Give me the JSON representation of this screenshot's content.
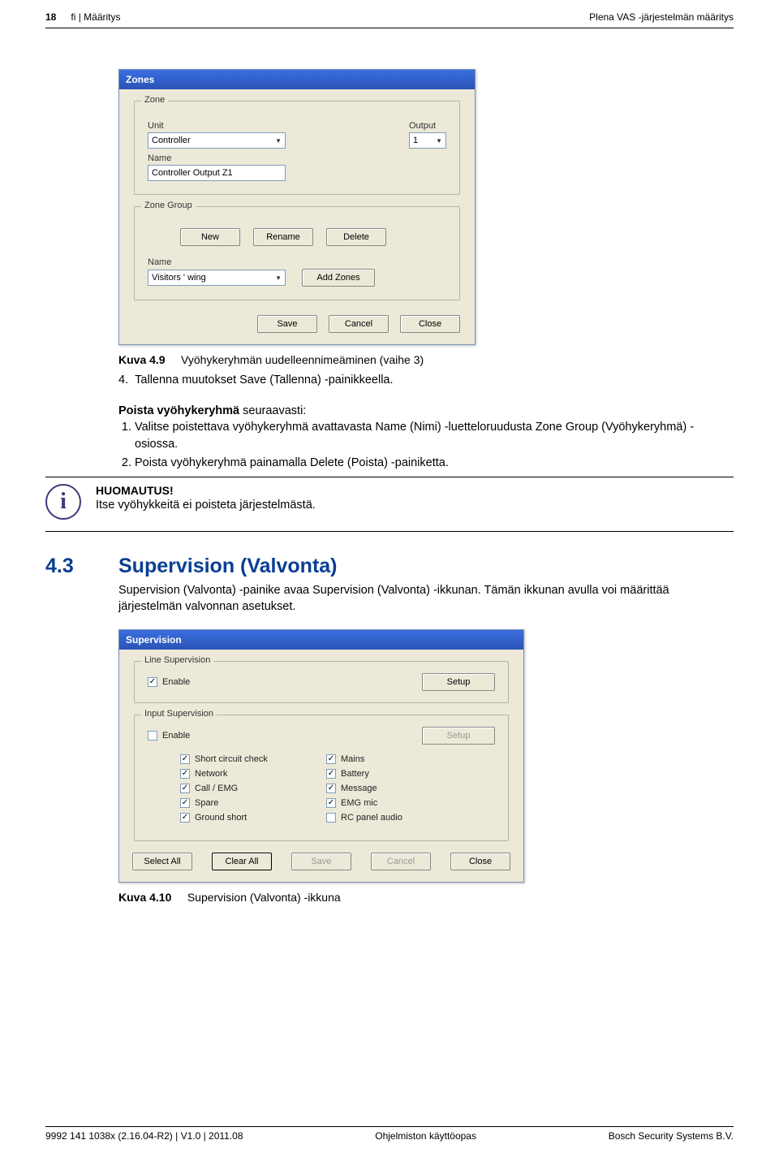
{
  "header": {
    "page_number": "18",
    "breadcrumb": "fi | Määritys",
    "doc_title": "Plena VAS -järjestelmän määritys"
  },
  "zones_window": {
    "title": "Zones",
    "group_zone": {
      "legend": "Zone",
      "unit_label": "Unit",
      "unit_value": "Controller",
      "output_label": "Output",
      "output_value": "1",
      "name_label": "Name",
      "name_value": "Controller Output Z1"
    },
    "group_zonegroup": {
      "legend": "Zone Group",
      "btn_new": "New",
      "btn_rename": "Rename",
      "btn_delete": "Delete",
      "name_label": "Name",
      "name_value": "Visitors ' wing",
      "btn_addzones": "Add Zones"
    },
    "bottom": {
      "save": "Save",
      "cancel": "Cancel",
      "close": "Close"
    }
  },
  "caption_49": {
    "label": "Kuva 4.9",
    "text": "Vyöhykeryhmän uudelleennimeäminen (vaihe 3)"
  },
  "step4": "Tallenna muutokset Save (Tallenna) -painikkeella.",
  "remove_heading_prefix": "Poista vyöhykeryhmä",
  "remove_heading_suffix": " seuraavasti:",
  "remove_steps": [
    "Valitse poistettava vyöhykeryhmä avattavasta Name (Nimi) -luetteloruudusta Zone Group (Vyöhykeryhmä) -osiossa.",
    "Poista vyöhykeryhmä painamalla Delete (Poista) -painiketta."
  ],
  "note": {
    "title": "HUOMAUTUS!",
    "body": "Itse vyöhykkeitä ei poisteta järjestelmästä."
  },
  "section43": {
    "num": "4.3",
    "title": "Supervision (Valvonta)",
    "body": "Supervision (Valvonta) -painike avaa Supervision (Valvonta) -ikkunan. Tämän ikkunan avulla voi määrittää järjestelmän valvonnan asetukset."
  },
  "supervision_window": {
    "title": "Supervision",
    "line_sup": {
      "legend": "Line Supervision",
      "enable": "Enable",
      "enable_checked": true,
      "setup": "Setup"
    },
    "input_sup": {
      "legend": "Input Supervision",
      "enable": "Enable",
      "enable_checked": false,
      "setup": "Setup"
    },
    "options": [
      {
        "label": "Short circuit check",
        "checked": true
      },
      {
        "label": "Mains",
        "checked": true
      },
      {
        "label": "Network",
        "checked": true
      },
      {
        "label": "Battery",
        "checked": true
      },
      {
        "label": "Call / EMG",
        "checked": true
      },
      {
        "label": "Message",
        "checked": true
      },
      {
        "label": "Spare",
        "checked": true
      },
      {
        "label": "EMG mic",
        "checked": true
      },
      {
        "label": "Ground short",
        "checked": true
      },
      {
        "label": "RC panel audio",
        "checked": false
      }
    ],
    "bottom": {
      "select_all": "Select All",
      "clear_all": "Clear All",
      "save": "Save",
      "cancel": "Cancel",
      "close": "Close"
    }
  },
  "caption_410": {
    "label": "Kuva 4.10",
    "text": "Supervision (Valvonta) -ikkuna"
  },
  "footer": {
    "left": "9992 141 1038x  (2.16.04-R2)  | V1.0 | 2011.08",
    "center": "Ohjelmiston käyttöopas",
    "right": "Bosch Security Systems B.V."
  }
}
